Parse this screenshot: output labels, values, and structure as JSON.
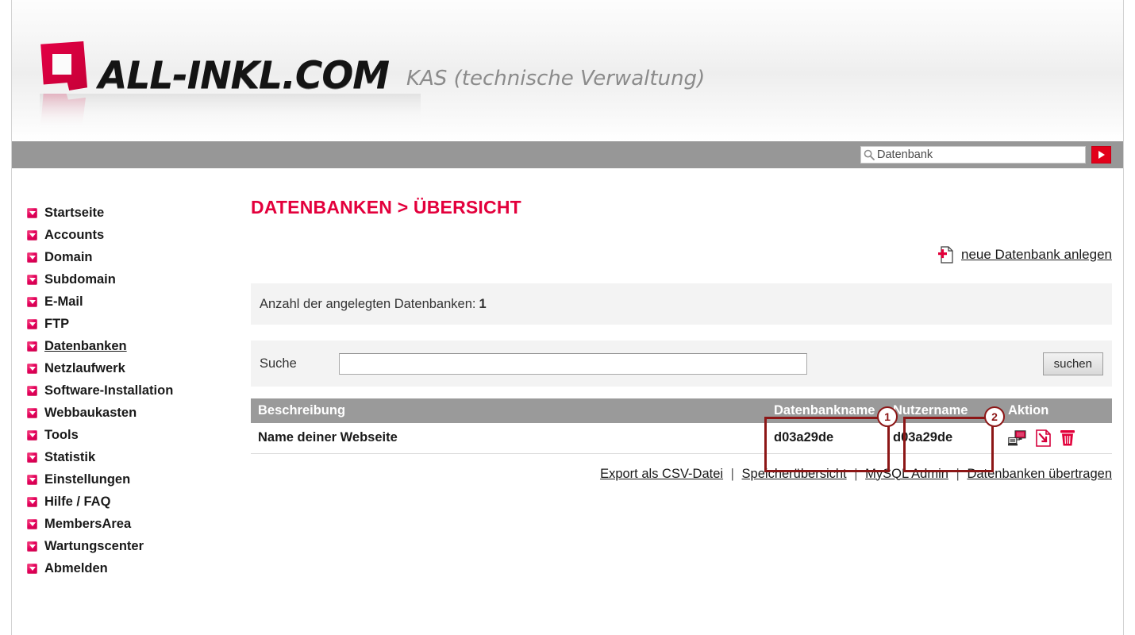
{
  "header": {
    "logo_text": "ALL-INKL.COM",
    "logo_subtitle": "KAS (technische Verwaltung)",
    "logo_icon": "allinkl-square-logo"
  },
  "topbar": {
    "search_value": "Datenbank",
    "search_placeholder": "Datenbank",
    "search_icon": "search-icon",
    "go_icon": "play-arrow-icon"
  },
  "sidebar": {
    "items": [
      {
        "label": "Startseite",
        "active": false
      },
      {
        "label": "Accounts",
        "active": false
      },
      {
        "label": "Domain",
        "active": false
      },
      {
        "label": "Subdomain",
        "active": false
      },
      {
        "label": "E-Mail",
        "active": false
      },
      {
        "label": "FTP",
        "active": false
      },
      {
        "label": "Datenbanken",
        "active": true
      },
      {
        "label": "Netzlaufwerk",
        "active": false
      },
      {
        "label": "Software-Installation",
        "active": false
      },
      {
        "label": "Webbaukasten",
        "active": false
      },
      {
        "label": "Tools",
        "active": false
      },
      {
        "label": "Statistik",
        "active": false
      },
      {
        "label": "Einstellungen",
        "active": false
      },
      {
        "label": "Hilfe / FAQ",
        "active": false
      },
      {
        "label": "MembersArea",
        "active": false
      },
      {
        "label": "Wartungscenter",
        "active": false
      },
      {
        "label": "Abmelden",
        "active": false
      }
    ]
  },
  "main": {
    "page_title": "DATENBANKEN > ÜBERSICHT",
    "new_db_link": "neue Datenbank anlegen",
    "new_db_icon": "document-plus-icon",
    "info_text": "Anzahl der angelegten Datenbanken:",
    "info_count": "1",
    "search": {
      "label": "Suche",
      "value": "",
      "placeholder": "",
      "button_label": "suchen"
    },
    "table": {
      "columns": [
        "Beschreibung",
        "Datenbankname",
        "Nutzername",
        "Aktion"
      ],
      "rows": [
        {
          "beschreibung": "Name deiner Webseite",
          "datenbankname": "d03a29de",
          "nutzername": "d03a29de",
          "actions": [
            "database-connect-icon",
            "document-export-icon",
            "trash-icon"
          ]
        }
      ]
    },
    "footer_links": [
      "Export als CSV-Datei",
      "Speicherübersicht",
      "MySQL Admin",
      "Datenbanken übertragen"
    ],
    "footer_separator": "|"
  },
  "annotations": [
    {
      "number": "1",
      "target": "Datenbankname column"
    },
    {
      "number": "2",
      "target": "Nutzername column"
    }
  ],
  "colors": {
    "brand_red": "#e3003c",
    "topbar_gray": "#979797",
    "table_header_gray": "#9a9a9a",
    "annotation_red": "#8c1616",
    "panel_gray": "#f3f3f3"
  }
}
